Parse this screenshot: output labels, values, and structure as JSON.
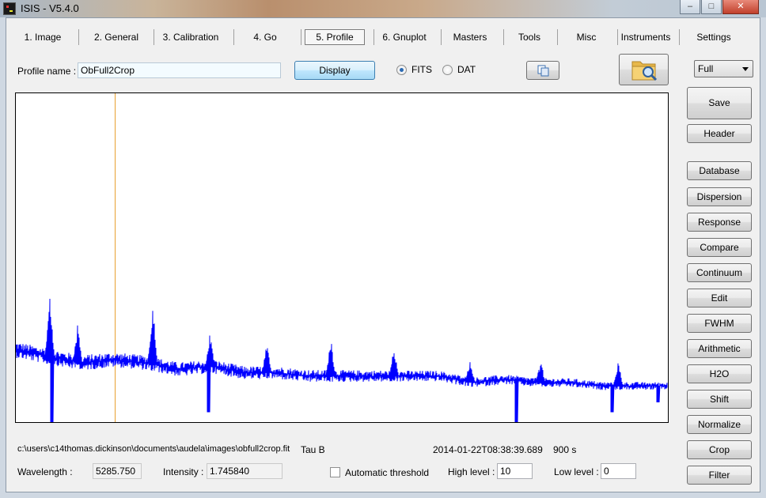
{
  "window": {
    "title": "ISIS - V5.4.0",
    "minimize_glyph": "–",
    "maximize_glyph": "□",
    "close_glyph": "✕"
  },
  "tabs": [
    "1. Image",
    "2. General",
    "3. Calibration",
    "4. Go",
    "5. Profile",
    "6. Gnuplot",
    "Masters",
    "Tools",
    "Misc",
    "Instruments",
    "Settings"
  ],
  "active_tab": "5. Profile",
  "toolbar": {
    "profile_name_label": "Profile name :",
    "profile_name_value": "ObFull2Crop",
    "display_button": "Display",
    "radio_fits_label": "FITS",
    "radio_dat_label": "DAT",
    "selected_format": "FITS",
    "copy_icon": "copy-icon",
    "open_folder_icon": "folder-search-icon"
  },
  "right_panel": {
    "zoom_select": "Full",
    "save": "Save",
    "header": "Header",
    "buttons": [
      "Database",
      "Dispersion",
      "Response",
      "Compare",
      "Continuum",
      "Edit",
      "FWHM",
      "Arithmetic",
      "H2O",
      "Shift",
      "Normalize",
      "Crop",
      "Filter"
    ]
  },
  "status": {
    "file_path": "c:\\users\\c14thomas.dickinson\\documents\\audela\\images\\obfull2crop.fit",
    "object": "Tau B",
    "date": "2014-01-22T08:38:39.689",
    "exposure": "900 s",
    "wavelength_label": "Wavelength :",
    "wavelength_value": "5285.750",
    "intensity_label": "Intensity :",
    "intensity_value": "1.745840",
    "auto_threshold_label": "Automatic threshold",
    "high_level_label": "High level :",
    "high_level_value": "10",
    "low_level_label": "Low level :",
    "low_level_value": "0"
  },
  "chart_data": {
    "type": "line",
    "title": "",
    "xlabel": "",
    "ylabel": "",
    "grid": false,
    "series_color": "#0000ff",
    "cursor_color": "#e8a030",
    "cursor_x": 0.152,
    "x": [
      0.0,
      0.05,
      0.1,
      0.15,
      0.2,
      0.25,
      0.3,
      0.35,
      0.4,
      0.45,
      0.5,
      0.55,
      0.6,
      0.65,
      0.7,
      0.75,
      0.8,
      0.85,
      0.9,
      0.95,
      1.0
    ],
    "values": [
      0.78,
      0.8,
      0.82,
      0.81,
      0.82,
      0.84,
      0.83,
      0.85,
      0.85,
      0.86,
      0.86,
      0.86,
      0.86,
      0.86,
      0.88,
      0.87,
      0.88,
      0.88,
      0.89,
      0.89,
      0.89
    ],
    "peaks": [
      {
        "x": 0.052,
        "y": 0.62
      },
      {
        "x": 0.095,
        "y": 0.7
      },
      {
        "x": 0.21,
        "y": 0.61
      },
      {
        "x": 0.298,
        "y": 0.72
      },
      {
        "x": 0.385,
        "y": 0.76
      },
      {
        "x": 0.483,
        "y": 0.73
      },
      {
        "x": 0.58,
        "y": 0.77
      },
      {
        "x": 0.697,
        "y": 0.8
      },
      {
        "x": 0.805,
        "y": 0.81
      },
      {
        "x": 0.924,
        "y": 0.81
      }
    ],
    "dips": [
      {
        "x": 0.055,
        "y": 1.0
      },
      {
        "x": 0.295,
        "y": 0.97
      },
      {
        "x": 0.768,
        "y": 1.0
      },
      {
        "x": 0.915,
        "y": 0.97
      },
      {
        "x": 0.985,
        "y": 0.94
      }
    ]
  }
}
